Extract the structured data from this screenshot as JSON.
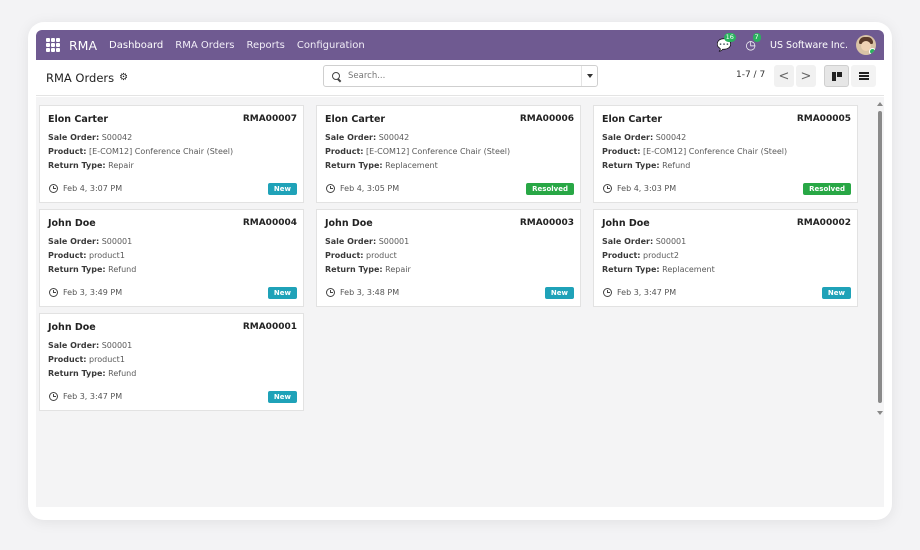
{
  "topbar": {
    "app_name": "RMA",
    "menu": [
      "Dashboard",
      "RMA Orders",
      "Reports",
      "Configuration"
    ],
    "chat_badge": "16",
    "activity_badge": "7",
    "company": "US Software Inc.",
    "color": "#6f5a91"
  },
  "controlbar": {
    "breadcrumb": "RMA Orders",
    "search_placeholder": "Search...",
    "pager": "1-7 / 7",
    "prev": "<",
    "next": ">"
  },
  "cards": [
    {
      "customer": "Elon Carter",
      "ref": "RMA00007",
      "sale_order_label": "Sale Order:",
      "sale_order": "S00042",
      "product_label": "Product:",
      "product": "[E-COM12] Conference Chair (Steel)",
      "return_type_label": "Return Type:",
      "return_type": "Repair",
      "date": "Feb 4, 3:07 PM",
      "status": "New"
    },
    {
      "customer": "Elon Carter",
      "ref": "RMA00006",
      "sale_order_label": "Sale Order:",
      "sale_order": "S00042",
      "product_label": "Product:",
      "product": "[E-COM12] Conference Chair (Steel)",
      "return_type_label": "Return Type:",
      "return_type": "Replacement",
      "date": "Feb 4, 3:05 PM",
      "status": "Resolved"
    },
    {
      "customer": "Elon Carter",
      "ref": "RMA00005",
      "sale_order_label": "Sale Order:",
      "sale_order": "S00042",
      "product_label": "Product:",
      "product": "[E-COM12] Conference Chair (Steel)",
      "return_type_label": "Return Type:",
      "return_type": "Refund",
      "date": "Feb 4, 3:03 PM",
      "status": "Resolved"
    },
    {
      "customer": "John Doe",
      "ref": "RMA00004",
      "sale_order_label": "Sale Order:",
      "sale_order": "S00001",
      "product_label": "Product:",
      "product": "product1",
      "return_type_label": "Return Type:",
      "return_type": "Refund",
      "date": "Feb 3, 3:49 PM",
      "status": "New"
    },
    {
      "customer": "John Doe",
      "ref": "RMA00003",
      "sale_order_label": "Sale Order:",
      "sale_order": "S00001",
      "product_label": "Product:",
      "product": "product",
      "return_type_label": "Return Type:",
      "return_type": "Repair",
      "date": "Feb 3, 3:48 PM",
      "status": "New"
    },
    {
      "customer": "John Doe",
      "ref": "RMA00002",
      "sale_order_label": "Sale Order:",
      "sale_order": "S00001",
      "product_label": "Product:",
      "product": "product2",
      "return_type_label": "Return Type:",
      "return_type": "Replacement",
      "date": "Feb 3, 3:47 PM",
      "status": "New"
    },
    {
      "customer": "John Doe",
      "ref": "RMA00001",
      "sale_order_label": "Sale Order:",
      "sale_order": "S00001",
      "product_label": "Product:",
      "product": "product1",
      "return_type_label": "Return Type:",
      "return_type": "Refund",
      "date": "Feb 3, 3:47 PM",
      "status": "New"
    }
  ],
  "status_colors": {
    "New": "#1fa2b8",
    "Resolved": "#28a745"
  }
}
